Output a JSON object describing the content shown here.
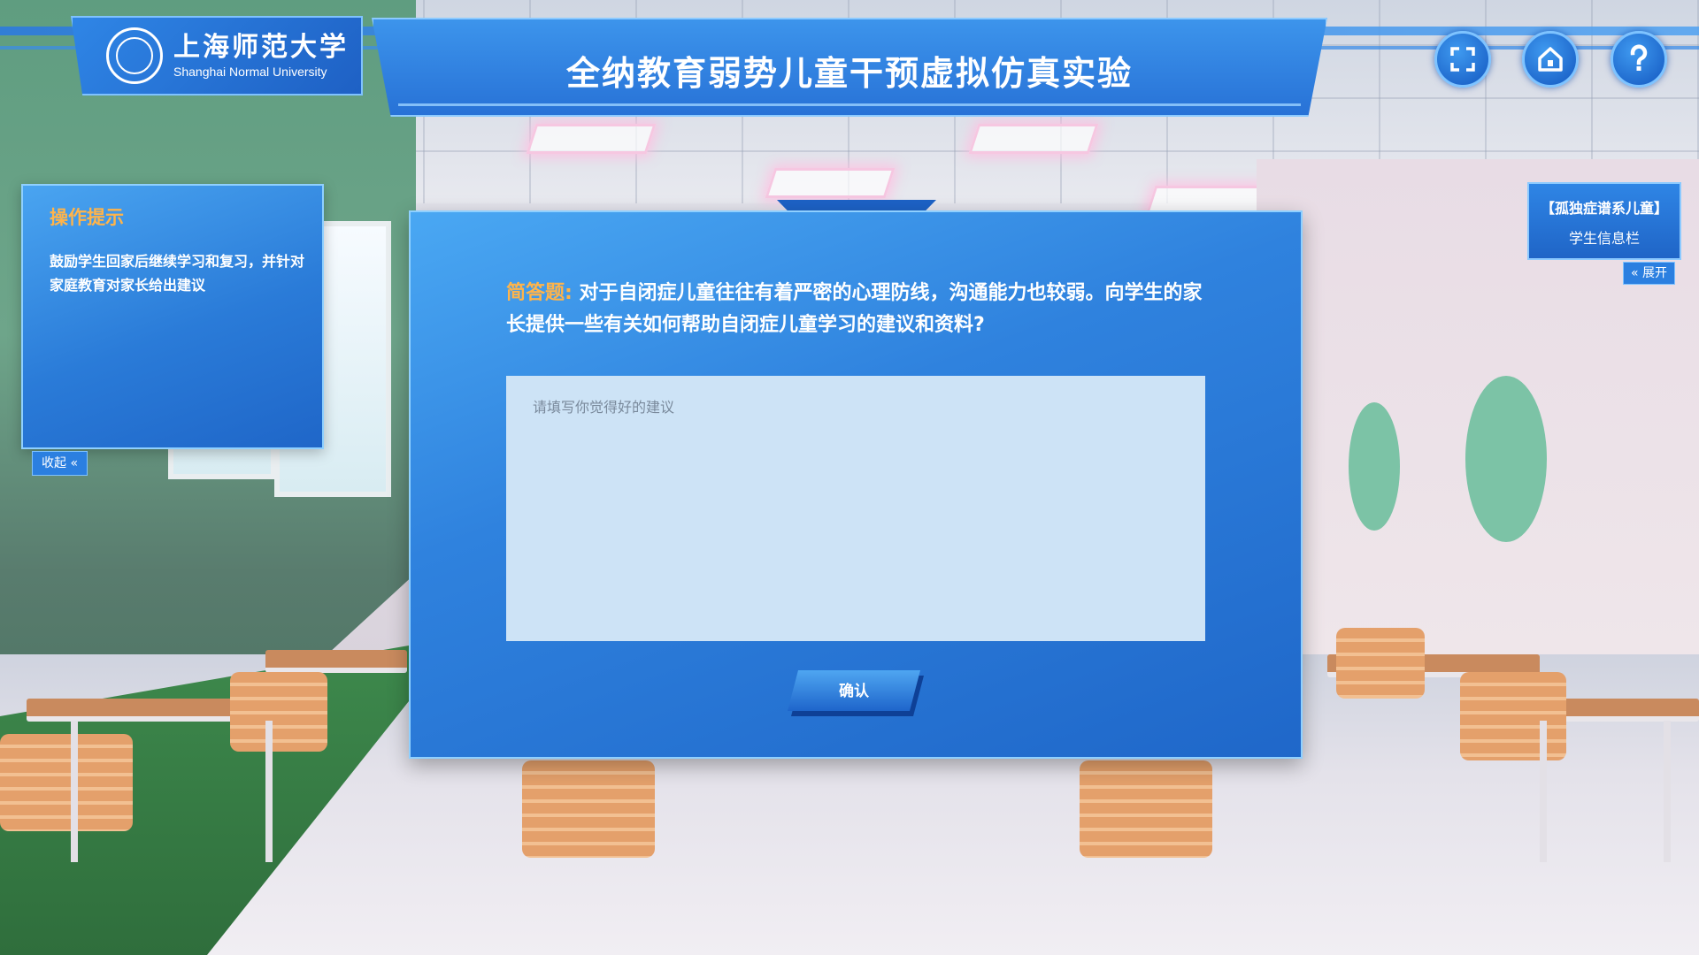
{
  "header": {
    "university_cn": "上海师范大学",
    "university_en": "Shanghai Normal University",
    "title": "全纳教育弱势儿童干预虚拟仿真实验",
    "controls": [
      {
        "icon": "fullscreen-icon"
      },
      {
        "icon": "home-icon"
      },
      {
        "icon": "help-icon"
      }
    ]
  },
  "tips_panel": {
    "title": "操作提示",
    "body": "鼓励学生回家后继续学习和复习，并针对家庭教育对家长给出建议",
    "collapse_label": "收起"
  },
  "info_panel": {
    "line1": "【孤独症谱系儿童】",
    "line2": "学生信息栏",
    "expand_label": "展开"
  },
  "dialog": {
    "question_label": "简答题:",
    "question_text": "对于自闭症儿童往往有着严密的心理防线，沟通能力也较弱。向学生的家长提供一些有关如何帮助自闭症儿童学习的建议和资料?",
    "answer_value": "",
    "answer_placeholder": "请填写你觉得好的建议",
    "confirm_label": "确认"
  },
  "colors": {
    "accent": "#2a7bd8",
    "highlight": "#ffb44a"
  }
}
